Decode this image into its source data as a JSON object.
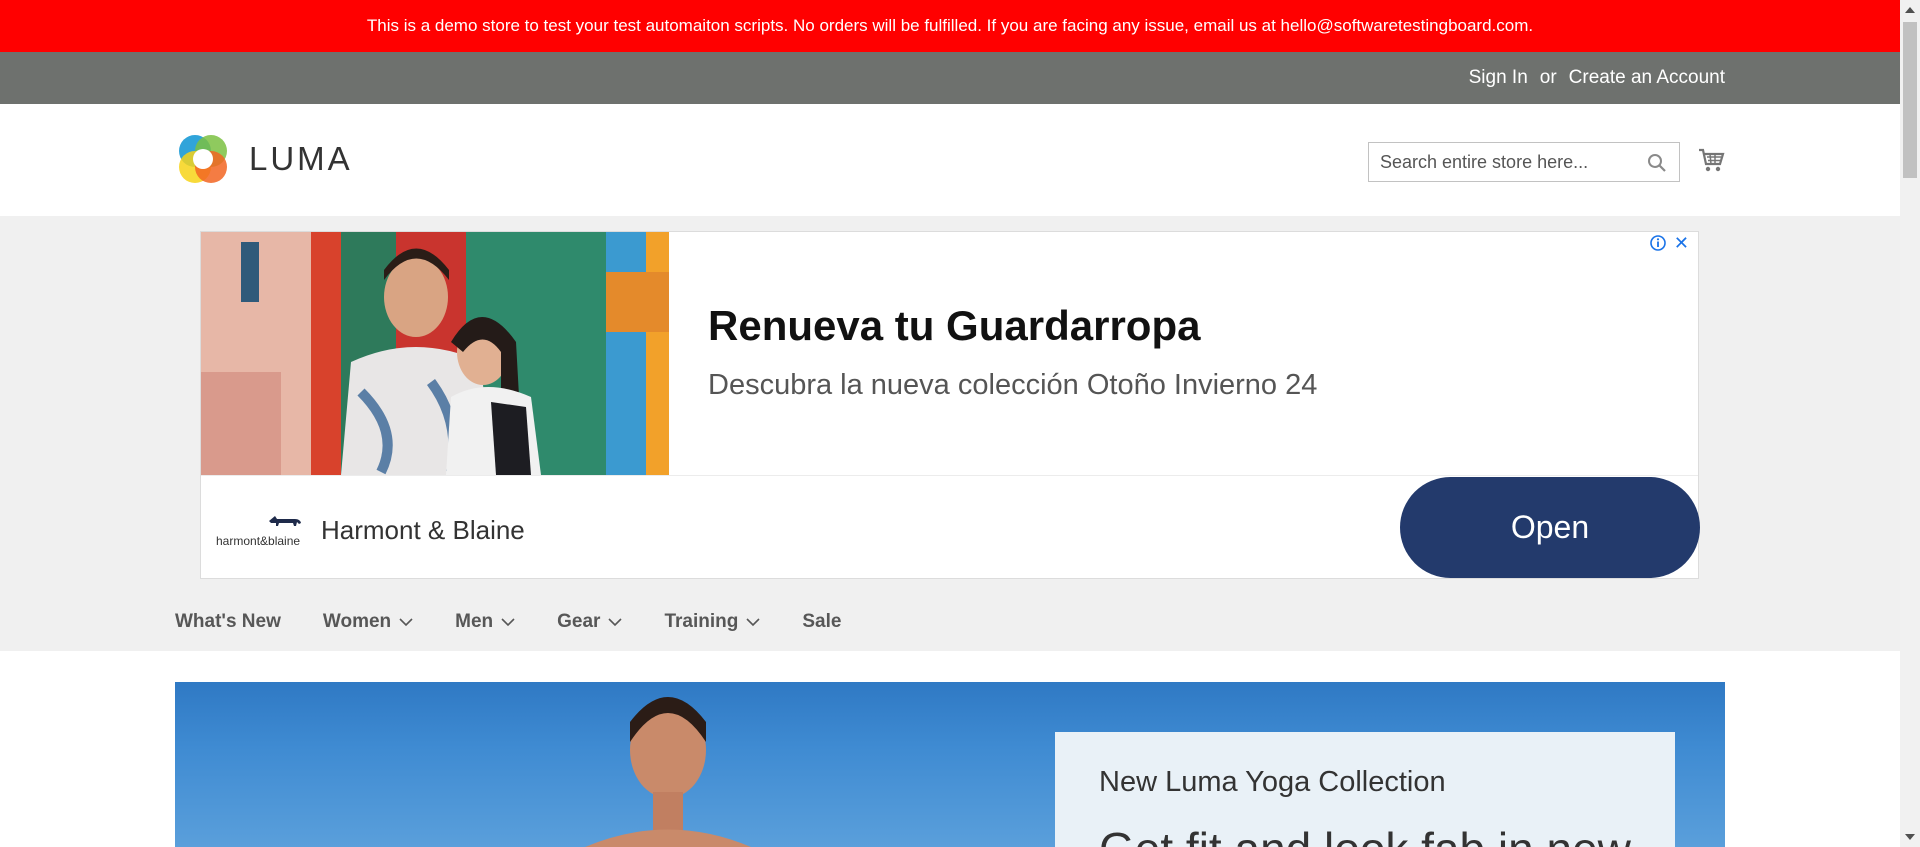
{
  "demo_notice": "This is a demo store to test your test automaiton scripts. No orders will be fulfilled. If you are facing any issue, email us at hello@softwaretestingboard.com.",
  "header": {
    "sign_in": "Sign In",
    "separator": "or",
    "create_account": "Create an Account"
  },
  "logo": {
    "text": "LUMA"
  },
  "search": {
    "placeholder": "Search entire store here..."
  },
  "ad": {
    "headline": "Renueva tu Guardarropa",
    "subheadline": "Descubra la nueva colección Otoño Invierno 24",
    "brand_logo_text": "harmont&blaine",
    "brand_name": "Harmont & Blaine",
    "cta": "Open",
    "cta_color": "#233a6c"
  },
  "nav": {
    "items": [
      {
        "label": "What's New",
        "has_dropdown": false
      },
      {
        "label": "Women",
        "has_dropdown": true
      },
      {
        "label": "Men",
        "has_dropdown": true
      },
      {
        "label": "Gear",
        "has_dropdown": true
      },
      {
        "label": "Training",
        "has_dropdown": true
      },
      {
        "label": "Sale",
        "has_dropdown": false
      }
    ]
  },
  "hero": {
    "title": "New Luma Yoga Collection",
    "subtitle": "Get fit and look fab in new"
  },
  "colors": {
    "demo_bar": "#ff0000",
    "panel_header": "#6e716e",
    "nav_band": "#f0f0f0"
  }
}
